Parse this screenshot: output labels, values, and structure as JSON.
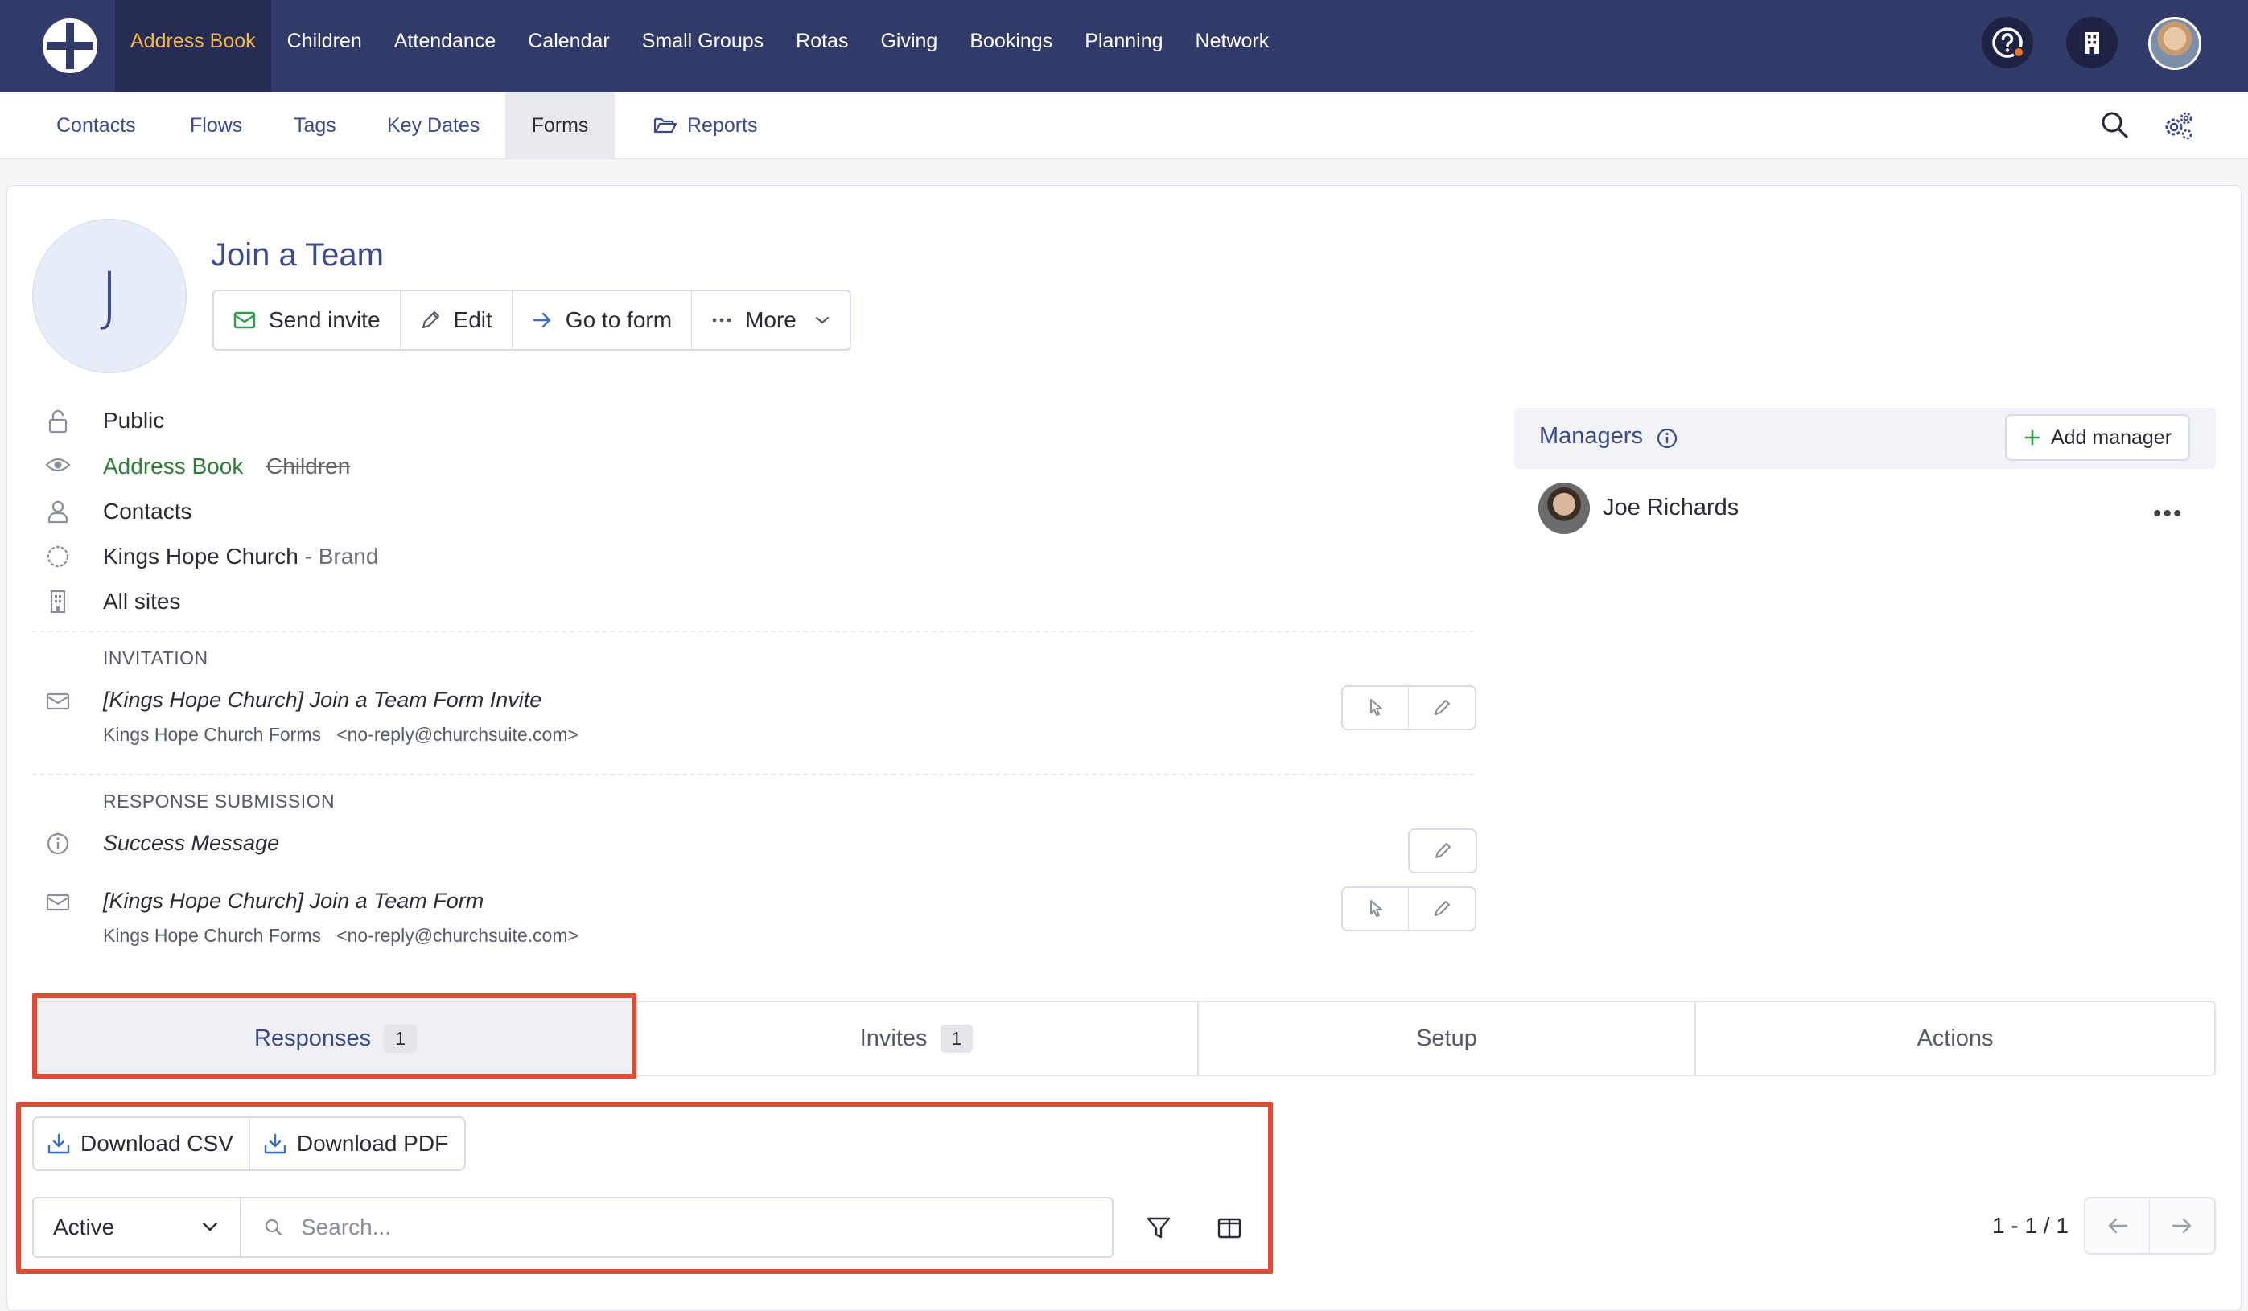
{
  "topnav": {
    "items": [
      "Address Book",
      "Children",
      "Attendance",
      "Calendar",
      "Small Groups",
      "Rotas",
      "Giving",
      "Bookings",
      "Planning",
      "Network"
    ],
    "active": "Address Book"
  },
  "subnav": {
    "contacts": "Contacts",
    "flows": "Flows",
    "tags": "Tags",
    "key_dates": "Key Dates",
    "forms": "Forms",
    "reports": "Reports"
  },
  "form": {
    "avatar_letter": "J",
    "title": "Join a Team",
    "actions": {
      "send_invite": "Send invite",
      "edit": "Edit",
      "go_to_form": "Go to form",
      "more": "More"
    }
  },
  "details": {
    "visibility": "Public",
    "module_active": "Address Book",
    "module_inactive": "Children",
    "audience": "Contacts",
    "brand_name": "Kings Hope Church",
    "brand_suffix": "- Brand",
    "sites": "All sites"
  },
  "invitation": {
    "label": "INVITATION",
    "subject": "[Kings Hope Church] Join a Team Form Invite",
    "sender_name": "Kings Hope Church Forms",
    "sender_email": "<no-reply@churchsuite.com>"
  },
  "response_submission": {
    "label": "RESPONSE SUBMISSION",
    "success": "Success Message",
    "subject": "[Kings Hope Church] Join a Team Form",
    "sender_name": "Kings Hope Church Forms",
    "sender_email": "<no-reply@churchsuite.com>"
  },
  "managers": {
    "title": "Managers",
    "add_label": "Add manager",
    "people": [
      {
        "name": "Joe Richards"
      }
    ]
  },
  "tabs": [
    {
      "label": "Responses",
      "count": "1"
    },
    {
      "label": "Invites",
      "count": "1"
    },
    {
      "label": "Setup"
    },
    {
      "label": "Actions"
    }
  ],
  "downloads": {
    "csv": "Download CSV",
    "pdf": "Download PDF"
  },
  "filters": {
    "status_value": "Active",
    "search_placeholder": "Search...",
    "pager_text": "1 - 1 / 1"
  },
  "colors": {
    "nav_bg": "#313a68",
    "nav_active_text": "#f1b941",
    "link_blue": "#3d4a8a",
    "green": "#2f7d39",
    "highlight": "#e14a33"
  }
}
